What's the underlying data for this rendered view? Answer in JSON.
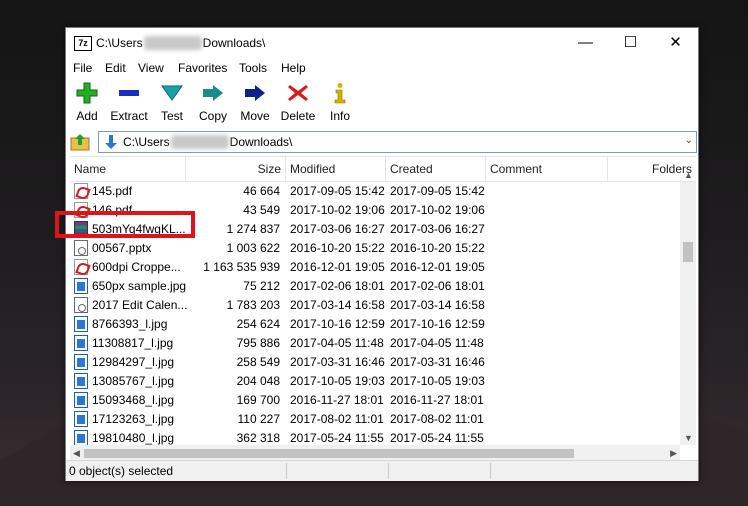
{
  "window": {
    "app_icon": "7z",
    "title_prefix": "C:\\Users",
    "title_suffix": "Downloads\\",
    "minimize": "—",
    "maximize": "☐",
    "close": "✕"
  },
  "menu": [
    "File",
    "Edit",
    "View",
    "Favorites",
    "Tools",
    "Help"
  ],
  "toolbar": [
    {
      "label": "Add",
      "icon": "add-icon",
      "color": "#22b022"
    },
    {
      "label": "Extract",
      "icon": "extract-icon",
      "color": "#1a2fbf"
    },
    {
      "label": "Test",
      "icon": "test-icon",
      "color": "#1aa0a8"
    },
    {
      "label": "Copy",
      "icon": "copy-icon",
      "color": "#1a7a7a"
    },
    {
      "label": "Move",
      "icon": "move-icon",
      "color": "#10208a"
    },
    {
      "label": "Delete",
      "icon": "delete-icon",
      "color": "#d81b1b"
    },
    {
      "label": "Info",
      "icon": "info-icon",
      "color": "#d8b400"
    }
  ],
  "address": {
    "prefix": "C:\\Users",
    "suffix": "Downloads\\"
  },
  "columns": [
    "Name",
    "Size",
    "Modified",
    "Created",
    "Comment",
    "Folders"
  ],
  "files": [
    {
      "name": "145.pdf",
      "size": "46 664",
      "modified": "2017-09-05 15:42",
      "created": "2017-09-05 15:42",
      "type": "pdf"
    },
    {
      "name": "146.pdf",
      "size": "43 549",
      "modified": "2017-10-02 19:06",
      "created": "2017-10-02 19:06",
      "type": "pdf"
    },
    {
      "name": "503mYq4fwgKL...",
      "size": "1 274 837",
      "modified": "2017-03-06 16:27",
      "created": "2017-03-06 16:27",
      "type": "rar"
    },
    {
      "name": "00567.pptx",
      "size": "1 003 622",
      "modified": "2016-10-20 15:22",
      "created": "2016-10-20 15:22",
      "type": "doc"
    },
    {
      "name": "600dpi Croppe...",
      "size": "1 163 535 939",
      "modified": "2016-12-01 19:05",
      "created": "2016-12-01 19:05",
      "type": "pdf"
    },
    {
      "name": "650px sample.jpg",
      "size": "75 212",
      "modified": "2017-02-06 18:01",
      "created": "2017-02-06 18:01",
      "type": "jpg"
    },
    {
      "name": "2017 Edit Calen...",
      "size": "1 783 203",
      "modified": "2017-03-14 16:58",
      "created": "2017-03-14 16:58",
      "type": "doc"
    },
    {
      "name": "8766393_l.jpg",
      "size": "254 624",
      "modified": "2017-10-16 12:59",
      "created": "2017-10-16 12:59",
      "type": "jpg"
    },
    {
      "name": "11308817_l.jpg",
      "size": "795 886",
      "modified": "2017-04-05 11:48",
      "created": "2017-04-05 11:48",
      "type": "jpg"
    },
    {
      "name": "12984297_l.jpg",
      "size": "258 549",
      "modified": "2017-03-31 16:46",
      "created": "2017-03-31 16:46",
      "type": "jpg"
    },
    {
      "name": "13085767_l.jpg",
      "size": "204 048",
      "modified": "2017-10-05 19:03",
      "created": "2017-10-05 19:03",
      "type": "jpg"
    },
    {
      "name": "15093468_l.jpg",
      "size": "169 700",
      "modified": "2016-11-27 18:01",
      "created": "2016-11-27 18:01",
      "type": "jpg"
    },
    {
      "name": "17123263_l.jpg",
      "size": "110 227",
      "modified": "2017-08-02 11:01",
      "created": "2017-08-02 11:01",
      "type": "jpg"
    },
    {
      "name": "19810480_l.jpg",
      "size": "362 318",
      "modified": "2017-05-24 11:55",
      "created": "2017-05-24 11:55",
      "type": "jpg"
    }
  ],
  "status": {
    "selected": "0 object(s) selected"
  },
  "highlight_color": "#e0131a"
}
